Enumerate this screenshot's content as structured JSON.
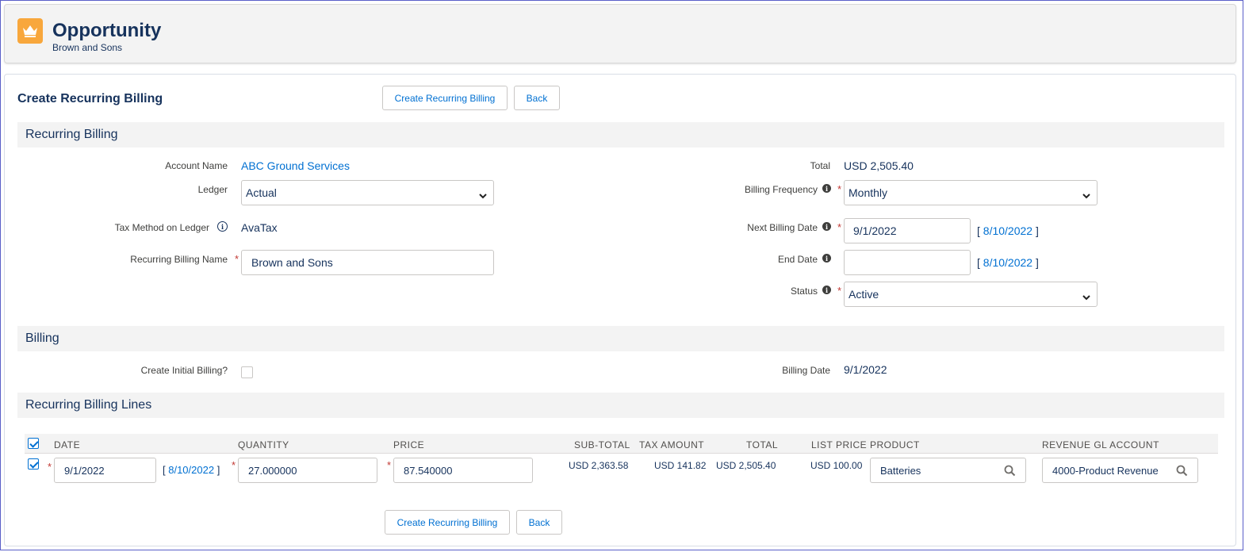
{
  "header": {
    "object_label": "Opportunity",
    "record_name": "Brown and Sons",
    "icon": "crown-icon"
  },
  "page": {
    "title": "Create Recurring Billing",
    "buttons": {
      "create": "Create Recurring Billing",
      "back": "Back"
    }
  },
  "sections": {
    "recurring_billing": "Recurring Billing",
    "billing": "Billing",
    "lines": "Recurring Billing Lines"
  },
  "fields": {
    "account_name_label": "Account Name",
    "account_name_value": "ABC Ground Services",
    "ledger_label": "Ledger",
    "ledger_value": "Actual",
    "tax_method_label": "Tax Method on Ledger",
    "tax_method_value": "AvaTax",
    "rb_name_label": "Recurring Billing Name",
    "rb_name_value": "Brown and Sons",
    "total_label": "Total",
    "total_value": "USD 2,505.40",
    "frequency_label": "Billing Frequency",
    "frequency_value": "Monthly",
    "next_date_label": "Next Billing Date",
    "next_date_value": "9/1/2022",
    "next_date_today": "8/10/2022",
    "end_date_label": "End Date",
    "end_date_value": "",
    "end_date_today": "8/10/2022",
    "status_label": "Status",
    "status_value": "Active",
    "create_initial_label": "Create Initial Billing?",
    "billing_date_label": "Billing Date",
    "billing_date_value": "9/1/2022"
  },
  "table": {
    "headers": {
      "date": "DATE",
      "quantity": "QUANTITY",
      "price": "PRICE",
      "subtotal": "SUB-TOTAL",
      "tax": "TAX AMOUNT",
      "total": "TOTAL",
      "list_price": "LIST PRICE",
      "product": "PRODUCT",
      "gl_account": "REVENUE GL ACCOUNT"
    },
    "row": {
      "date": "9/1/2022",
      "date_today": "8/10/2022",
      "quantity": "27.000000",
      "price": "87.540000",
      "subtotal": "USD 2,363.58",
      "tax": "USD 141.82",
      "total": "USD 2,505.40",
      "list_price": "USD 100.00",
      "product": "Batteries",
      "gl_account": "4000-Product Revenue"
    }
  }
}
